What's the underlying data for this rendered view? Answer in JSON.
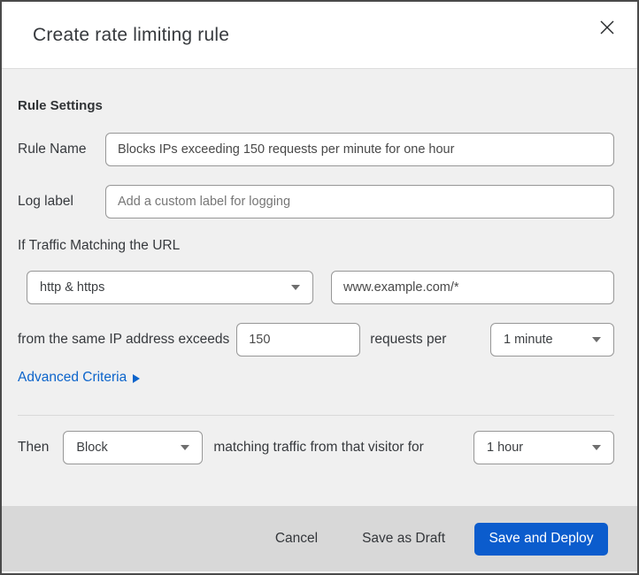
{
  "modal": {
    "title": "Create rate limiting rule"
  },
  "rule_settings": {
    "heading": "Rule Settings",
    "rule_name": {
      "label": "Rule Name",
      "value": "Blocks IPs exceeding 150 requests per minute for one hour"
    },
    "log_label": {
      "label": "Log label",
      "placeholder": "Add a custom label for logging"
    }
  },
  "traffic_match": {
    "heading": "If Traffic Matching the URL",
    "scheme_select": {
      "value": "http & https"
    },
    "url_input": {
      "value": "www.example.com/*"
    },
    "threshold": {
      "prefix": "from the same IP address exceeds",
      "requests_value": "150",
      "middle": "requests per",
      "period_select": {
        "value": "1 minute"
      }
    },
    "advanced_link": "Advanced Criteria"
  },
  "action": {
    "then_label": "Then",
    "action_select": {
      "value": "Block"
    },
    "middle": "matching traffic from that visitor for",
    "duration_select": {
      "value": "1 hour"
    }
  },
  "footer": {
    "cancel": "Cancel",
    "save_draft": "Save as Draft",
    "save_deploy": "Save and Deploy"
  },
  "colors": {
    "body_bg": "#f0f0f0",
    "footer_bg": "#d8d8d8",
    "primary_button": "#0b5ccd",
    "link_blue": "#0c64cb",
    "input_border": "#979797",
    "page_strip": "#0d1f30"
  }
}
